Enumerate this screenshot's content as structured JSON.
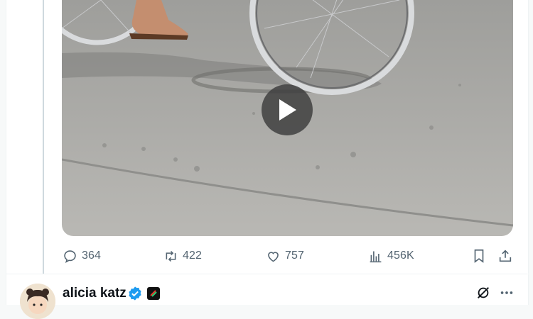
{
  "post": {
    "actions": {
      "replies": "364",
      "reposts": "422",
      "likes": "757",
      "views": "456K"
    }
  },
  "next_post": {
    "author_name": "alicia katz"
  },
  "colors": {
    "icon_gray": "#536471",
    "verified_blue": "#1d9bf0",
    "thread_line": "#cfd9de"
  },
  "icons": [
    "play-icon",
    "reply-icon",
    "repost-icon",
    "like-icon",
    "views-icon",
    "bookmark-icon",
    "share-icon",
    "verified-badge-icon",
    "grok-icon",
    "more-icon"
  ]
}
